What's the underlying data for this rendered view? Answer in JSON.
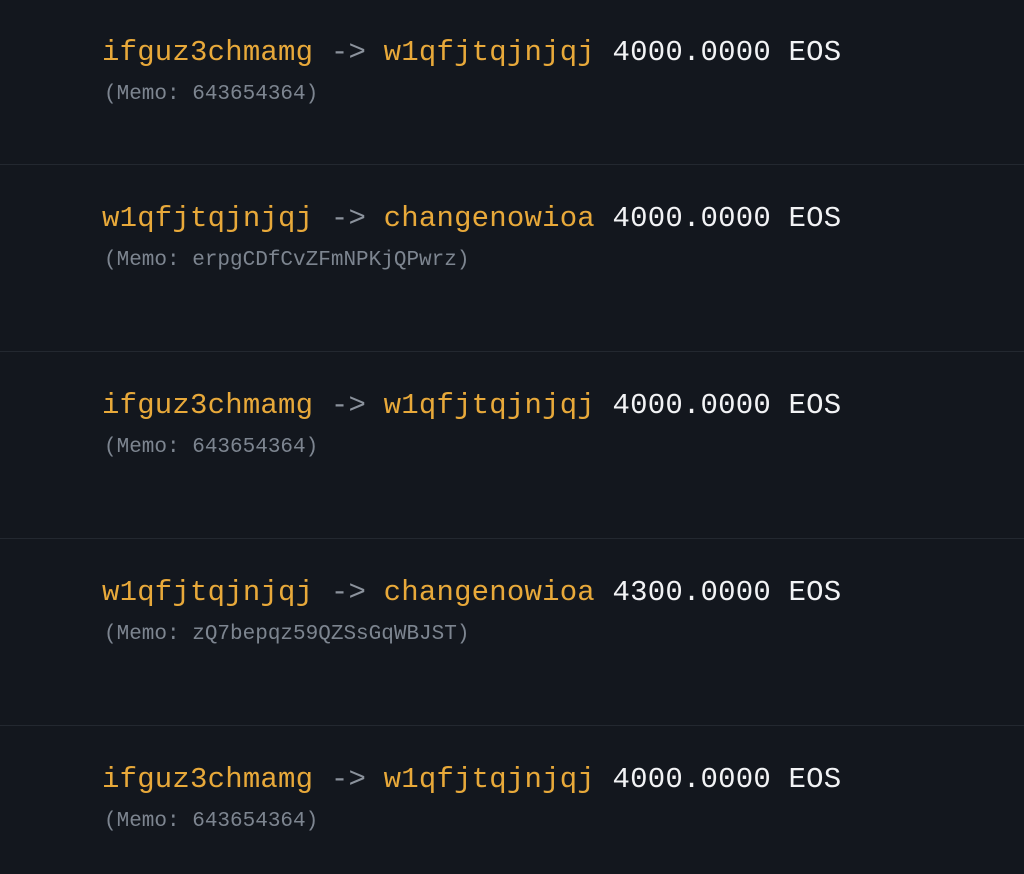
{
  "transactions": [
    {
      "from": "ifguz3chmamg",
      "arrow": "->",
      "to": "w1qfjtqjnjqj",
      "amount": "4000.0000 EOS",
      "memo": "(Memo: 643654364)"
    },
    {
      "from": "w1qfjtqjnjqj",
      "arrow": "->",
      "to": "changenowioa",
      "amount": "4000.0000 EOS",
      "memo": "(Memo: erpgCDfCvZFmNPKjQPwrz)"
    },
    {
      "from": "ifguz3chmamg",
      "arrow": "->",
      "to": "w1qfjtqjnjqj",
      "amount": "4000.0000 EOS",
      "memo": "(Memo: 643654364)"
    },
    {
      "from": "w1qfjtqjnjqj",
      "arrow": "->",
      "to": "changenowioa",
      "amount": "4300.0000 EOS",
      "memo": "(Memo: zQ7bepqz59QZSsGqWBJST)"
    },
    {
      "from": "ifguz3chmamg",
      "arrow": "->",
      "to": "w1qfjtqjnjqj",
      "amount": "4000.0000 EOS",
      "memo": "(Memo: 643654364)"
    }
  ],
  "colors": {
    "background": "#13171e",
    "account": "#e8a93a",
    "arrow": "#8b929c",
    "amount": "#f2f3f5",
    "memo": "#7d8590",
    "divider": "#232830"
  }
}
